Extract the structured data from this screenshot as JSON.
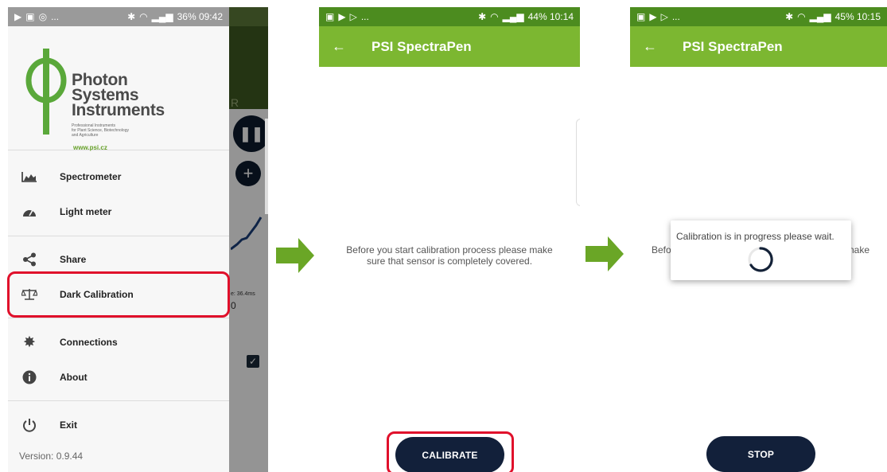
{
  "screens": {
    "drawer": {
      "status": {
        "left": "...",
        "right": "36% 09:42"
      },
      "logo": {
        "brand_lines": [
          "Photon",
          "Systems",
          "Instruments"
        ],
        "tagline_lines": [
          "Professional Instruments",
          "for Plant Science, Biotechnology",
          "and Agriculture"
        ],
        "website": "www.psi.cz"
      },
      "menu_items": [
        {
          "label": "Spectrometer",
          "icon": "chart-area-icon"
        },
        {
          "label": "Light meter",
          "icon": "gauge-icon"
        },
        {
          "label": "Share",
          "icon": "share-icon"
        },
        {
          "label": "Dark Calibration",
          "icon": "balance-scale-icon"
        },
        {
          "label": "Connections",
          "icon": "gear-icon"
        },
        {
          "label": "About",
          "icon": "info-icon"
        },
        {
          "label": "Exit",
          "icon": "power-icon"
        }
      ],
      "version": "Version: 0.9.44",
      "background": {
        "letter": "R",
        "readout_small": "e: 36.4ms",
        "readout_value": "0"
      }
    },
    "calibrate": {
      "status": {
        "left": "...",
        "right": "44% 10:14"
      },
      "title": "PSI SpectraPen",
      "instruction": "Before you start calibration process please make sure that sensor is completely covered.",
      "button_label": "CALIBRATE"
    },
    "progress": {
      "status": {
        "left": "...",
        "right": "45% 10:15"
      },
      "title": "PSI SpectraPen",
      "instruction_left": "Befo",
      "instruction_right": "nake",
      "dialog_message": "Calibration is in progress please wait.",
      "button_label": "STOP"
    }
  },
  "colors": {
    "accent_green": "#7cb731",
    "status_green": "#4c8c1f",
    "button_navy": "#12203a",
    "highlight_red": "#e0102b",
    "arrow_green": "#6aa626"
  }
}
